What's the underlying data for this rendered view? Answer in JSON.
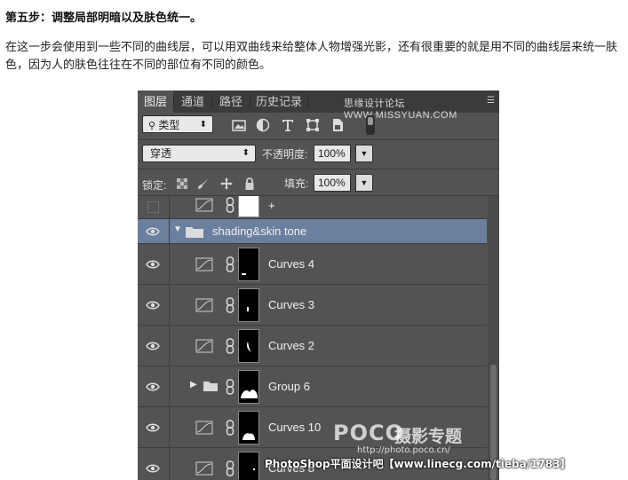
{
  "article": {
    "heading": "第五步：调整局部明暗以及肤色统一。",
    "paragraph": "在这一步会使用到一些不同的曲线层，可以用双曲线来给整体人物增强光影，还有很重要的就是用不同的曲线层来统一肤色，因为人的肤色往往在不同的部位有不同的颜色。"
  },
  "panel": {
    "tabs": [
      "图层",
      "通道",
      "路径",
      "历史记录"
    ],
    "active_tab": "图层",
    "watermark": "思缘设计论坛 WWW.MISSYUAN.COM",
    "filter_label": "类型",
    "filter_arrow": "⬍",
    "blend_mode": "穿透",
    "blend_arrow": "⬍",
    "opacity_label": "不透明度:",
    "opacity_value": "100%",
    "lock_label": "锁定:",
    "fill_label": "填充:",
    "fill_value": "100%",
    "dropdown_arrow": "▼",
    "icons": [
      "search-icon",
      "image-filter-icon",
      "adjustment-filter-icon",
      "type-filter-icon",
      "shape-filter-icon",
      "smart-object-filter-icon"
    ]
  },
  "layers": [
    {
      "name": "+",
      "kind": "curves",
      "mask": "white",
      "partial": true
    },
    {
      "name": "shading&skin tone",
      "kind": "group-open",
      "selected": true
    },
    {
      "name": "Curves 4",
      "kind": "curves",
      "mask": "black"
    },
    {
      "name": "Curves 3",
      "kind": "curves",
      "mask": "black"
    },
    {
      "name": "Curves 2",
      "kind": "curves",
      "mask": "black"
    },
    {
      "name": "Group 6",
      "kind": "group-closed",
      "mask": "black"
    },
    {
      "name": "Curves 10",
      "kind": "curves",
      "mask": "black"
    },
    {
      "name": "Curves 8",
      "kind": "curves",
      "mask": "black"
    }
  ],
  "overlay": {
    "poco_logo": "POCO",
    "poco_title": "摄影专题",
    "poco_url": "http://photo.poco.cn/",
    "bottom_credit": "PhotoShop平面设计吧【www.linecg.com/tieba/1783】"
  }
}
